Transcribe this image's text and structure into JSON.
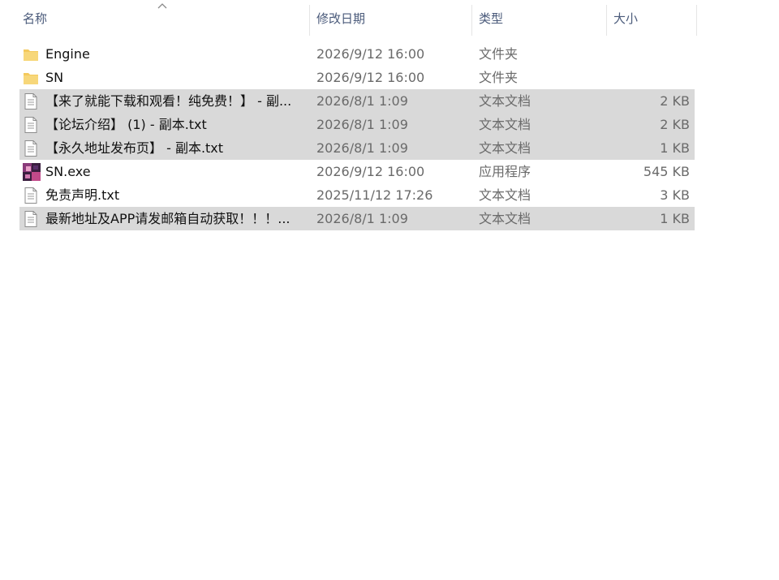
{
  "columns": {
    "name": "名称",
    "date": "修改日期",
    "type": "类型",
    "size": "大小"
  },
  "files": [
    {
      "name": "Engine",
      "date": "2026/9/12 16:00",
      "type": "文件夹",
      "size": "",
      "icon": "folder-icon",
      "selected": false
    },
    {
      "name": "SN",
      "date": "2026/9/12 16:00",
      "type": "文件夹",
      "size": "",
      "icon": "folder-icon",
      "selected": false
    },
    {
      "name": "【来了就能下载和观看！纯免费！】 - 副...",
      "date": "2026/8/1 1:09",
      "type": "文本文档",
      "size": "2 KB",
      "icon": "text-file-icon",
      "selected": true
    },
    {
      "name": "【论坛介绍】 (1) - 副本.txt",
      "date": "2026/8/1 1:09",
      "type": "文本文档",
      "size": "2 KB",
      "icon": "text-file-icon",
      "selected": true
    },
    {
      "name": "【永久地址发布页】 - 副本.txt",
      "date": "2026/8/1 1:09",
      "type": "文本文档",
      "size": "1 KB",
      "icon": "text-file-icon",
      "selected": true
    },
    {
      "name": "SN.exe",
      "date": "2026/9/12 16:00",
      "type": "应用程序",
      "size": "545 KB",
      "icon": "app-icon",
      "selected": false
    },
    {
      "name": "免责声明.txt",
      "date": "2025/11/12 17:26",
      "type": "文本文档",
      "size": "3 KB",
      "icon": "text-file-icon",
      "selected": false
    },
    {
      "name": "最新地址及APP请发邮箱自动获取！！！...",
      "date": "2026/8/1 1:09",
      "type": "文本文档",
      "size": "1 KB",
      "icon": "text-file-icon",
      "selected": true
    }
  ],
  "colors": {
    "selected_row": "#d9d9d9",
    "folder": "#f4c95d",
    "header_text": "#4a5a7a"
  }
}
